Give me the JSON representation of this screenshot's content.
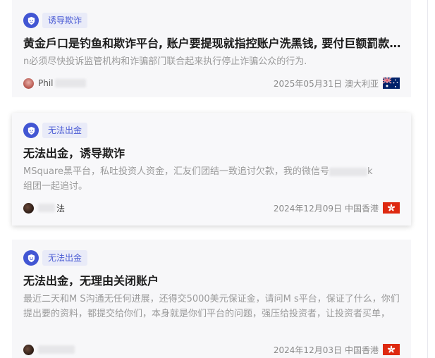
{
  "posts": [
    {
      "tag": "诱导欺诈",
      "title": "黄金戶口是钓鱼和欺诈平台, 账户要提现就指控账户洗黑钱, 要付巨额罰款以及保证金，...",
      "desc": "n必须尽快投诉监管机构和诈骗部门联合起来执行停止诈骗公众的行为.",
      "user": "Phil",
      "date": "2025年05月31日",
      "region": "澳大利亚",
      "flag": "australia-flag-icon"
    },
    {
      "tag": "无法出金",
      "title": "无法出金，诱导欺诈",
      "desc_a": "MSquare黑平台，私吐投资人资金，汇友们团结一致追讨欠款，我的微信号",
      "desc_b": "k",
      "desc_c": "组团一起追讨。",
      "user": "法",
      "date": "2024年12月09日",
      "region": "中国香港",
      "flag": "hong-kong-flag-icon"
    },
    {
      "tag": "无法出金",
      "title": "无法出金，无理由关闭账户",
      "desc": "最近二天和M S沟通无任何进展，还得交5000美元保证金，请问M s平台，保证了什么，你们提出要的资料，都提交给你们，本身就是你们平台的问题，强压给投资者，让投资者买单，",
      "user": "",
      "date": "2024年12月03日",
      "region": "中国香港",
      "flag": "hong-kong-flag-icon"
    }
  ],
  "colors": {
    "accent": "#4256d3",
    "tag_bg": "#e9ebf8",
    "flag_red": "#de2910"
  }
}
